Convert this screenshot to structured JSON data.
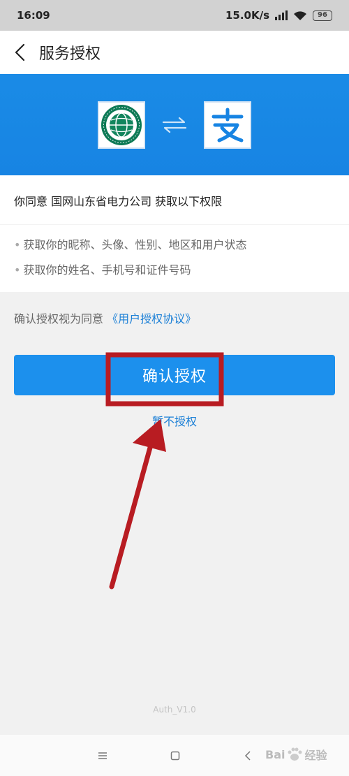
{
  "status_bar": {
    "time": "16:09",
    "network_speed": "15.0K/s",
    "battery": "96"
  },
  "nav": {
    "title": "服务授权"
  },
  "banner": {
    "left_logo": "sgcc-logo",
    "right_logo": "alipay-logo",
    "swap_icon": "swap-arrows-icon",
    "brand_color": "#1784e3"
  },
  "permissions": {
    "consent_text": "你同意 国网山东省电力公司 获取以下权限",
    "items": [
      "获取你的昵称、头像、性别、地区和用户状态",
      "获取你的姓名、手机号和证件号码"
    ]
  },
  "agreement": {
    "prefix": "确认授权视为同意",
    "link": "《用户授权协议》"
  },
  "actions": {
    "confirm_label": "确认授权",
    "later_label": "暂不授权",
    "confirm_color": "#1c90ed"
  },
  "footer": {
    "version": "Auth_V1.0"
  },
  "annotation": {
    "highlight_color": "#b81c22"
  }
}
